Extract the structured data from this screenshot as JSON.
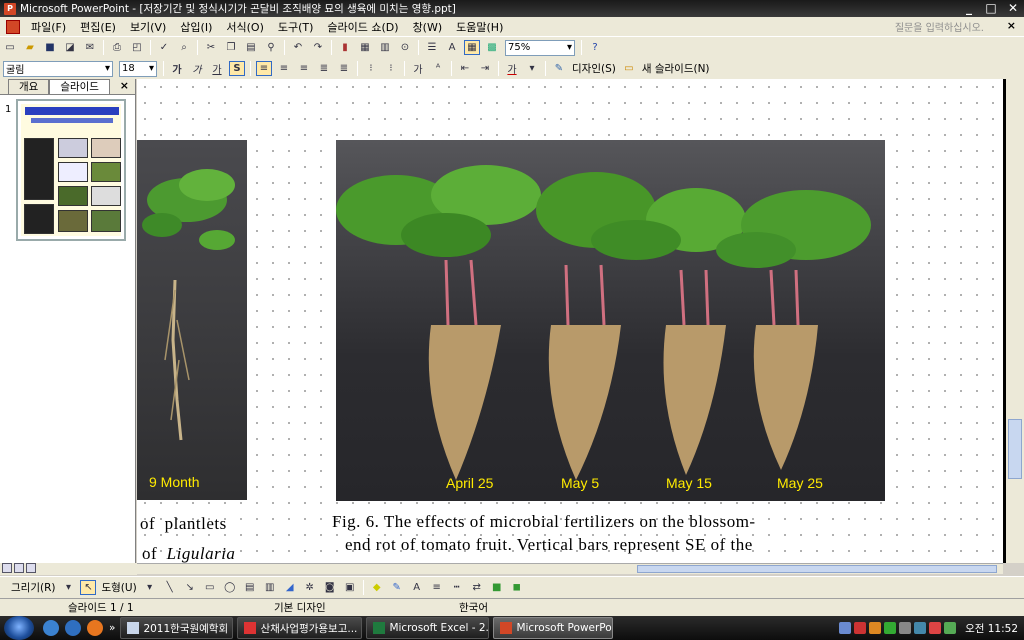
{
  "window": {
    "title": "Microsoft PowerPoint - [저장기간 및 정식시기가 곤달비 조직배양 묘의 생육에 미치는 영향.ppt]",
    "controls": [
      "_",
      "□",
      "✕"
    ]
  },
  "menu": {
    "items": [
      "파일(F)",
      "편집(E)",
      "보기(V)",
      "삽입(I)",
      "서식(O)",
      "도구(T)",
      "슬라이드 쇼(D)",
      "창(W)",
      "도움말(H)"
    ],
    "help_placeholder": "질문을 입력하십시오.",
    "close": "×"
  },
  "toolbar1": {
    "zoom": "75%"
  },
  "toolbar2": {
    "font_name": "굴림",
    "font_size": "18",
    "bold": "가",
    "italic": "가",
    "underline": "가",
    "shadow": "S",
    "grow_font": "가",
    "font_color": "가",
    "design_label": "디자인(S)",
    "new_slide_label": "새 슬라이드(N)"
  },
  "left_pane": {
    "tabs": [
      "개요",
      "슬라이드"
    ],
    "close": "×",
    "slide_number": "1"
  },
  "slide": {
    "photo_left_label": "9 Month",
    "photo_main_labels": [
      "April 25",
      "May 5",
      "May 15",
      "May 25"
    ],
    "text_left_line1": "of  plantlets",
    "text_left_line2_prefix": "of  ",
    "text_left_line2_italic": "Ligularia",
    "fig_caption_line1": "Fig. 6. The effects of microbial fertilizers on the blossom-",
    "fig_caption_line2": "end rot of tomato fruit. Vertical bars represent SE of the"
  },
  "drawbar": {
    "draw_label": "그리기(R)",
    "shapes_label": "도형(U)"
  },
  "status": {
    "slide_info": "슬라이드 1 / 1",
    "design": "기본 디자인",
    "language": "한국어"
  },
  "taskbar": {
    "tasks": [
      "2011한국원예학회 ...",
      "산채사업평가용보고...",
      "Microsoft Excel - 2...",
      "Microsoft PowerPo..."
    ],
    "clock": "오전 11:52"
  },
  "colors": {
    "caption_yellow": "#ffeb00",
    "title_bar": "#1a1a1a"
  }
}
